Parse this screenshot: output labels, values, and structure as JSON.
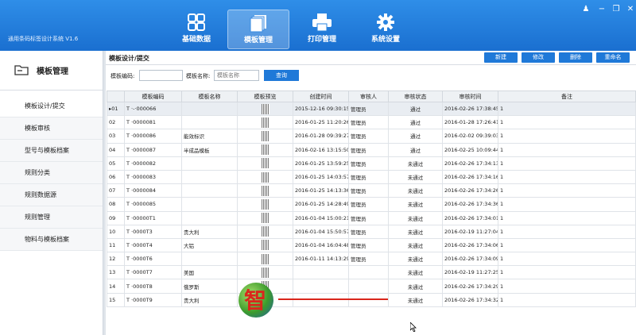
{
  "app": {
    "title": "通用条码标签设计系统 V1.6"
  },
  "nav": [
    {
      "label": "基础数据",
      "icon": "grid-icon",
      "active": false
    },
    {
      "label": "模板管理",
      "icon": "templates-icon",
      "active": true
    },
    {
      "label": "打印管理",
      "icon": "printer-icon",
      "active": false
    },
    {
      "label": "系统设置",
      "icon": "gear-icon",
      "active": false
    }
  ],
  "window_controls": [
    "user-icon",
    "minimize-icon",
    "maximize-icon",
    "close-icon"
  ],
  "sidebar": {
    "header": "模板管理",
    "items": [
      {
        "label": "模板设计/提交",
        "active": true
      },
      {
        "label": "模板审核",
        "active": false
      },
      {
        "label": "型号与模板档案",
        "active": false
      },
      {
        "label": "规则分类",
        "active": false
      },
      {
        "label": "规则数据源",
        "active": false
      },
      {
        "label": "规则管理",
        "active": false
      },
      {
        "label": "物料与模板档案",
        "active": false
      }
    ]
  },
  "main": {
    "title": "模板设计/提交",
    "buttons": {
      "new": "新建",
      "edit": "修改",
      "delete": "删除",
      "rename": "重命名"
    },
    "search": {
      "code_label": "模板编码:",
      "code_value": "",
      "name_label": "模板名称:",
      "name_placeholder": "模板名称",
      "query_button": "查询"
    },
    "table": {
      "columns": [
        "",
        "模板编码",
        "模板名称",
        "模板预览",
        "创建时间",
        "审核人",
        "审核状态",
        "审核时间",
        "备注"
      ],
      "rows": [
        {
          "no": "01",
          "code": "T ·-·000066",
          "name": "",
          "created": "2015-12-16 09:30:15",
          "reviewer": "管理员",
          "status": "通过",
          "reviewed": "2016-02-26 17:38:45",
          "note": "1",
          "selected": true
        },
        {
          "no": "02",
          "code": "T ·0000081",
          "name": "",
          "created": "2016-01-25 11:20:26",
          "reviewer": "管理员",
          "status": "通过",
          "reviewed": "2016-01-28 17:26:41",
          "note": "1",
          "selected": false
        },
        {
          "no": "03",
          "code": "T ·0000086",
          "name": "能效标识",
          "created": "2016-01-28 09:39:27",
          "reviewer": "管理员",
          "status": "通过",
          "reviewed": "2016-02-02 09:39:03",
          "note": "1",
          "selected": false
        },
        {
          "no": "04",
          "code": "T ·0000087",
          "name": "半成品模板",
          "created": "2016-02-16 13:15:50",
          "reviewer": "管理员",
          "status": "通过",
          "reviewed": "2016-02-25 10:09:44",
          "note": "1",
          "selected": false
        },
        {
          "no": "05",
          "code": "T ·0000082",
          "name": "",
          "created": "2016-01-25 13:59:25",
          "reviewer": "管理员",
          "status": "未通过",
          "reviewed": "2016-02-26 17:34:13",
          "note": "1",
          "selected": false
        },
        {
          "no": "06",
          "code": "T ·0000083",
          "name": "",
          "created": "2016-01-25 14:03:57",
          "reviewer": "管理员",
          "status": "未通过",
          "reviewed": "2016-02-26 17:34:16",
          "note": "1",
          "selected": false
        },
        {
          "no": "07",
          "code": "T ·0000084",
          "name": "",
          "created": "2016-01-25 14:13:36",
          "reviewer": "管理员",
          "status": "未通过",
          "reviewed": "2016-02-26 17:34:26",
          "note": "1",
          "selected": false
        },
        {
          "no": "08",
          "code": "T ·0000085",
          "name": "",
          "created": "2016-01-25 14:28:49",
          "reviewer": "管理员",
          "status": "未通过",
          "reviewed": "2016-02-26 17:34:36",
          "note": "1",
          "selected": false
        },
        {
          "no": "09",
          "code": "T ·00000T1",
          "name": "",
          "created": "2016-01-04 15:00:21",
          "reviewer": "管理员",
          "status": "未通过",
          "reviewed": "2016-02-26 17:34:01",
          "note": "1",
          "selected": false
        },
        {
          "no": "10",
          "code": "T ·0000T3",
          "name": "贵大利",
          "created": "2016-01-04 15:50:57",
          "reviewer": "管理员",
          "status": "未通过",
          "reviewed": "2016-02-19 11:27:04",
          "note": "1",
          "selected": false
        },
        {
          "no": "11",
          "code": "T ·0000T4",
          "name": "大铝",
          "created": "2016-01-04 16:04:48",
          "reviewer": "管理员",
          "status": "未通过",
          "reviewed": "2016-02-26 17:34:06",
          "note": "1",
          "selected": false
        },
        {
          "no": "12",
          "code": "T ·0000T6",
          "name": "",
          "created": "2016-01-11 14:13:29",
          "reviewer": "管理员",
          "status": "未通过",
          "reviewed": "2016-02-26 17:34:09",
          "note": "1",
          "selected": false
        },
        {
          "no": "13",
          "code": "T ·0000T7",
          "name": "美国",
          "created": "",
          "reviewer": "",
          "status": "未通过",
          "reviewed": "2016-02-19 11:27:25",
          "note": "1",
          "selected": false
        },
        {
          "no": "14",
          "code": "T ·0000T8",
          "name": "俄罗斯",
          "created": "",
          "reviewer": "",
          "status": "未通过",
          "reviewed": "2016-02-26 17:34:29",
          "note": "1",
          "selected": false
        },
        {
          "no": "15",
          "code": "T ·0000T9",
          "name": "贵大利",
          "created": "",
          "reviewer": "",
          "status": "未通过",
          "reviewed": "2016-02-26 17:34:32",
          "note": "1",
          "selected": false
        }
      ]
    }
  },
  "watermark": {
    "char": "智"
  },
  "colors": {
    "header": "#1f79d8",
    "button": "#1f79d8",
    "watermark_red": "#d9261c"
  }
}
